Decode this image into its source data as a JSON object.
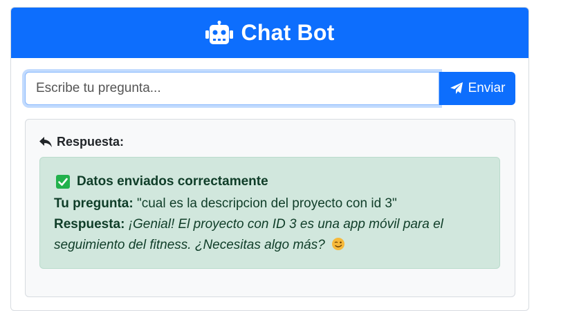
{
  "header": {
    "icon": "robot-icon",
    "title": "Chat Bot",
    "color": "#0d6efd"
  },
  "form": {
    "input_value": "",
    "input_placeholder": "Escribe tu pregunta...",
    "send_icon": "paper-plane-icon",
    "send_label": "Enviar"
  },
  "response": {
    "heading_icon": "reply-icon",
    "heading": "Respuesta:",
    "alert": {
      "icon": "check-square-icon",
      "title": "Datos enviados correctamente",
      "question_label": "Tu pregunta:",
      "question_text": "\"cual es la descripcion del proyecto con id 3\"",
      "answer_label": "Respuesta:",
      "answer_text": "¡Genial! El proyecto con ID 3 es una app móvil para el seguimiento del fitness. ¿Necesitas algo más?",
      "answer_emoji": "wink-emoji-icon",
      "background": "#d1e7dd",
      "accent": "#0f3d28"
    }
  }
}
